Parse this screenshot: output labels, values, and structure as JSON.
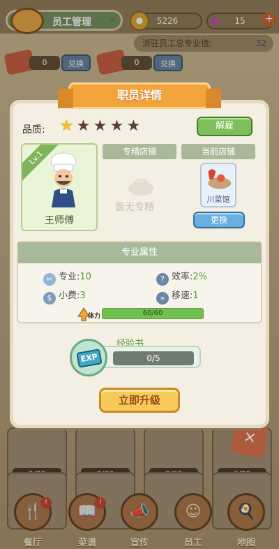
{
  "header": {
    "title": "员工管理",
    "coins": "5226",
    "gems": "15",
    "pro_label": "派驻员工总专业值:",
    "pro_value": "32",
    "exchange_1": {
      "count": "0",
      "button": "兑换"
    },
    "exchange_2": {
      "count": "0",
      "button": "兑换"
    }
  },
  "background_tiles": {
    "counts": [
      "0/80",
      "0/80",
      "0/80",
      "0/80"
    ]
  },
  "bottom_nav": [
    {
      "label": "餐厅",
      "icon": "restaurant-icon",
      "badge": "!"
    },
    {
      "label": "菜谱",
      "icon": "recipe-icon",
      "badge": "!"
    },
    {
      "label": "宣传",
      "icon": "megaphone-icon"
    },
    {
      "label": "员工",
      "icon": "staff-icon"
    },
    {
      "label": "地图",
      "icon": "map-icon"
    }
  ],
  "dialog": {
    "title": "职员详情",
    "quality_label": "品质:",
    "stars_total": 5,
    "stars_filled": 1,
    "fire_button": "解雇",
    "employee": {
      "level": "Lv.1",
      "name": "王师傅"
    },
    "specialty_tab": "专精店铺",
    "current_tab": "当前店铺",
    "no_specialty": "暂无专精",
    "current_shop": "川菜馆",
    "swap_button": "更换",
    "attributes": {
      "header": "专业属性",
      "skill_label": "专业:",
      "skill_value": "10",
      "efficiency_label": "效率:",
      "efficiency_value": "2%",
      "tips_label": "小费:",
      "tips_value": "3",
      "speed_label": "移速:",
      "speed_value": "1"
    },
    "stamina": {
      "label": "体力",
      "text": "60/60",
      "fraction": 1.0
    },
    "exp": {
      "label": "经验书",
      "icon_text": "EXP",
      "progress": "0/5"
    },
    "upgrade_button": "立即升级"
  },
  "colors": {
    "accent": "#f2a43a",
    "green": "#7dbf5a",
    "blue": "#6aaee0"
  }
}
